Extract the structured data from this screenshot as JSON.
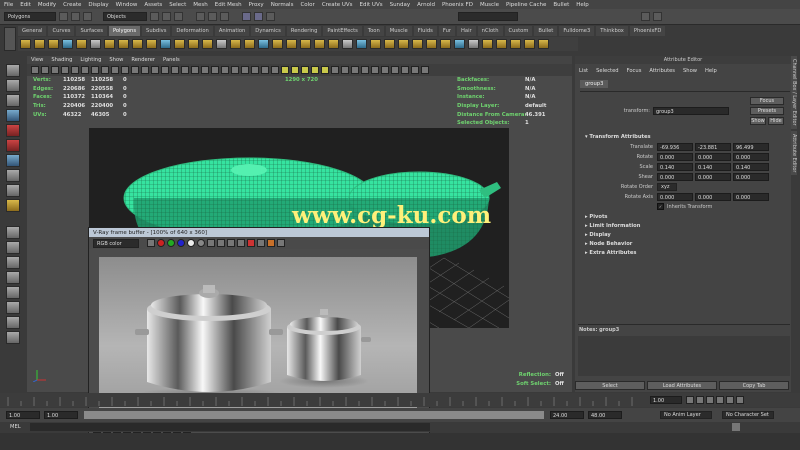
{
  "menubar": [
    "File",
    "Edit",
    "Modify",
    "Create",
    "Display",
    "Window",
    "Assets",
    "Select",
    "Mesh",
    "Edit Mesh",
    "Proxy",
    "Normals",
    "Color",
    "Create UVs",
    "Edit UVs",
    "Sunday",
    "Arnold",
    "Phoenix FD",
    "Muscle",
    "Pipeline Cache",
    "Bullet",
    "Help"
  ],
  "status": {
    "mode": "Polygons",
    "objects": "Objects"
  },
  "shelf_tabs": [
    "General",
    "Curves",
    "Surfaces",
    "Polygons",
    "Subdivs",
    "Deformation",
    "Animation",
    "Dynamics",
    "Rendering",
    "PaintEffects",
    "Toon",
    "Muscle",
    "Fluids",
    "Fur",
    "Hair",
    "nCloth",
    "Custom",
    "Bullet",
    "Fulldome3",
    "Thinkbox",
    "PhoenixFD"
  ],
  "shelf_active": "Polygons",
  "viewport": {
    "menu": [
      "View",
      "Shading",
      "Lighting",
      "Show",
      "Renderer",
      "Panels"
    ],
    "resolution": "1290 x 720",
    "hud_left": [
      {
        "label": "Verts:",
        "v1": "110258",
        "v2": "110258",
        "v3": "0"
      },
      {
        "label": "Edges:",
        "v1": "220686",
        "v2": "220558",
        "v3": "0"
      },
      {
        "label": "Faces:",
        "v1": "110372",
        "v2": "110364",
        "v3": "0"
      },
      {
        "label": "Tris:",
        "v1": "220406",
        "v2": "220400",
        "v3": "0"
      },
      {
        "label": "UVs:",
        "v1": "46322",
        "v2": "46305",
        "v3": "0"
      }
    ],
    "hud_right": [
      {
        "label": "Backfaces:",
        "value": "N/A"
      },
      {
        "label": "Smoothness:",
        "value": "N/A"
      },
      {
        "label": "Instance:",
        "value": "N/A"
      },
      {
        "label": "Display Layer:",
        "value": "default"
      },
      {
        "label": "Distance From Camera:",
        "value": "46.391"
      },
      {
        "label": "Selected Objects:",
        "value": "1"
      }
    ],
    "hud_bottom": [
      {
        "label": "Reflection:",
        "value": "Off"
      },
      {
        "label": "Soft Select:",
        "value": "Off"
      }
    ]
  },
  "watermark": "www.cg-ku.com",
  "vfb": {
    "title": "V-Ray frame buffer - [100% of 640 x 360]",
    "channel": "RGB color"
  },
  "attribute_editor": {
    "title": "Attribute Editor",
    "menu": [
      "List",
      "Selected",
      "Focus",
      "Attributes",
      "Show",
      "Help"
    ],
    "tab": "group3",
    "transform_label": "transform:",
    "transform_value": "group3",
    "focus_btn": "Focus",
    "presets_btn": "Presets",
    "show_btn": "Show",
    "hide_btn": "Hide",
    "section_transform": "Transform Attributes",
    "attrs": [
      {
        "label": "Translate",
        "vals": [
          "-69.936",
          "-23.881",
          "96.499"
        ]
      },
      {
        "label": "Rotate",
        "vals": [
          "0.000",
          "0.000",
          "0.000"
        ]
      },
      {
        "label": "Scale",
        "vals": [
          "0.140",
          "0.140",
          "0.140"
        ]
      },
      {
        "label": "Shear",
        "vals": [
          "0.000",
          "0.000",
          "0.000"
        ]
      }
    ],
    "rotate_order_label": "Rotate Order",
    "rotate_order": "xyz",
    "rotate_axis_label": "Rotate Axis",
    "rotate_axis": [
      "0.000",
      "0.000",
      "0.000"
    ],
    "inherits": "Inherits Transform",
    "sections": [
      "Pivots",
      "Limit Information",
      "Display",
      "Node Behavior",
      "Extra Attributes"
    ],
    "notes": "Notes: group3",
    "bottom_buttons": [
      "Select",
      "Load Attributes",
      "Copy Tab"
    ]
  },
  "right_tabs": [
    "Channel Box / Layer Editor",
    "Attribute Editor"
  ],
  "timeline": {
    "end_field": "1.00"
  },
  "range": {
    "start": "1.00",
    "start2": "1.00",
    "end1": "24.00",
    "end2": "48.00",
    "anim_layer": "No Anim Layer",
    "char_set": "No Character Set",
    "current": "1"
  },
  "cmd": {
    "label": "MEL"
  }
}
